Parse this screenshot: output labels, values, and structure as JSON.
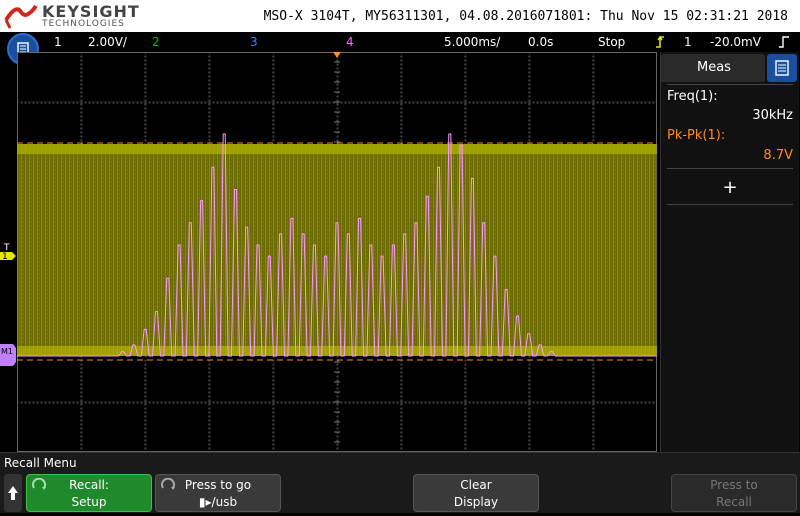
{
  "brand": {
    "name": "KEYSIGHT",
    "sub": "TECHNOLOGIES"
  },
  "device_info": "MSO-X 3104T, MY56311301, 04.08.2016071801: Thu Nov 15 02:31:21 2018",
  "status": {
    "ch1_num": "1",
    "ch1_scale": "2.00V/",
    "ch2_num": "2",
    "ch3_num": "3",
    "ch4_num": "4",
    "timebase": "5.000ms/",
    "delay": "0.0s",
    "run_state": "Stop",
    "trigger_channel": "1",
    "trigger_level": "-20.0mV"
  },
  "colors": {
    "ch1": "#e6e600",
    "ch2": "#00c000",
    "ch3": "#4a7bff",
    "ch4": "#ff66ff",
    "math": "#c080ff",
    "softkey_green": "#1f8a2c",
    "accent_blue": "#1a4f9e"
  },
  "markers": {
    "ch1_label": "1",
    "math_label": "M1"
  },
  "meas": {
    "tab_label": "Meas",
    "freq_label": "Freq(1):",
    "freq_value": "30kHz",
    "pkpk_label": "Pk-Pk(1):",
    "pkpk_value": "8.7V",
    "add_label": "+"
  },
  "menu": {
    "title": "Recall Menu",
    "softkeys": [
      {
        "line1": "Recall:",
        "line2": "Setup"
      },
      {
        "line1": "Press to go",
        "line2": "▮▸/usb"
      },
      {
        "line1": "Clear",
        "line2": "Display"
      },
      {
        "line1": "Press to",
        "line2": "Recall"
      }
    ]
  },
  "math_envelope": {
    "peaks": [
      0.02,
      0.05,
      0.12,
      0.2,
      0.35,
      0.5,
      0.6,
      0.7,
      0.85,
      1.0,
      0.75,
      0.58,
      0.5,
      0.45,
      0.55,
      0.62,
      0.55,
      0.5,
      0.45,
      0.6,
      0.55,
      0.62,
      0.5,
      0.45,
      0.5,
      0.55,
      0.6,
      0.72,
      0.85,
      1.0,
      0.95,
      0.8,
      0.6,
      0.45,
      0.3,
      0.18,
      0.1,
      0.05,
      0.02
    ]
  }
}
